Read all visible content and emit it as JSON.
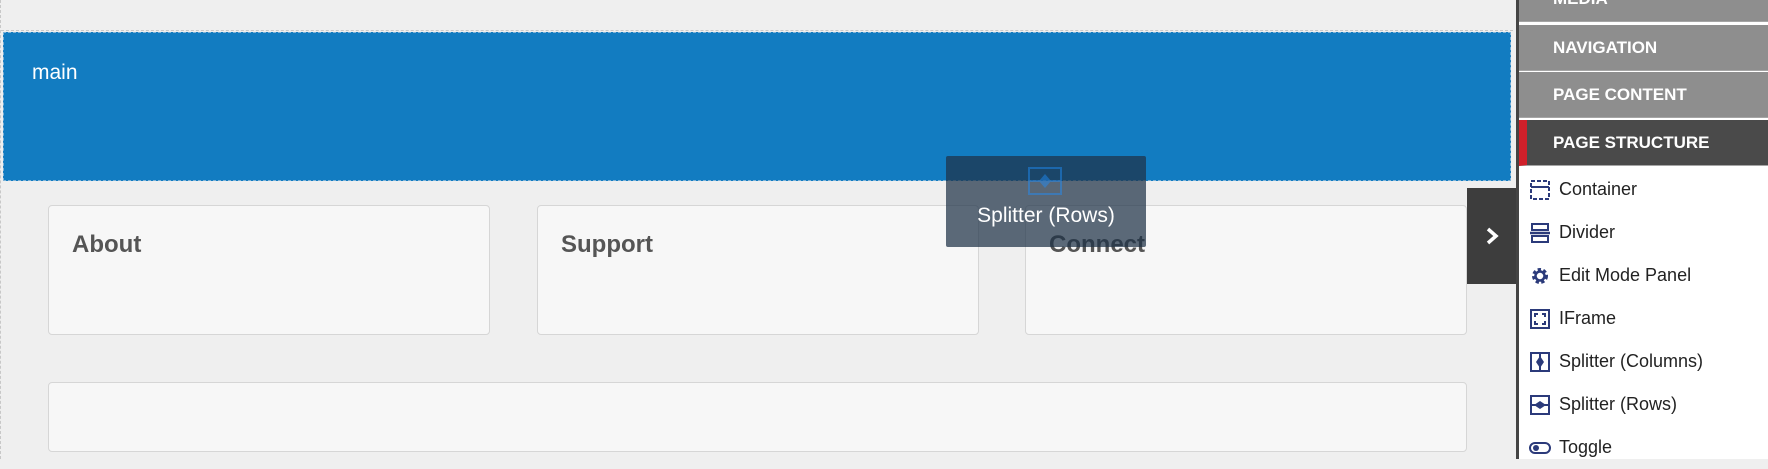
{
  "canvas": {
    "main_label": "main",
    "cards": [
      {
        "title": "About"
      },
      {
        "title": "Support"
      },
      {
        "title": "Connect"
      }
    ]
  },
  "drag_ghost": {
    "label": "Splitter (Rows)",
    "icon": "splitter-rows-icon"
  },
  "panel_toggle": {
    "icon": "chevron-right-icon"
  },
  "sidebar": {
    "categories": [
      {
        "label": "MEDIA"
      },
      {
        "label": "NAVIGATION"
      },
      {
        "label": "PAGE CONTENT"
      },
      {
        "label": "PAGE STRUCTURE",
        "active": true
      }
    ],
    "items": [
      {
        "label": "Container",
        "icon": "container-icon"
      },
      {
        "label": "Divider",
        "icon": "divider-icon"
      },
      {
        "label": "Edit Mode Panel",
        "icon": "gear-icon"
      },
      {
        "label": "IFrame",
        "icon": "iframe-icon"
      },
      {
        "label": "Splitter (Columns)",
        "icon": "splitter-columns-icon"
      },
      {
        "label": "Splitter (Rows)",
        "icon": "splitter-rows-icon"
      },
      {
        "label": "Toggle",
        "icon": "toggle-icon"
      }
    ]
  },
  "colors": {
    "main_band": "#127cc1",
    "active_marker": "#d0202a",
    "icon": "#2b3a7a"
  }
}
